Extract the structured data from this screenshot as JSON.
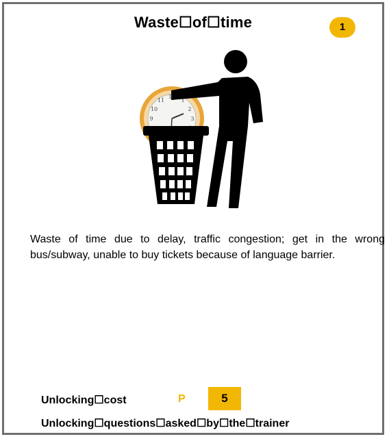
{
  "card": {
    "title": "Waste☐of☐time",
    "number": "1",
    "description": "Waste of time due to delay, traffic congestion; get in the wrong bus/subway, unable to buy tickets because of language barrier.",
    "unlocking_cost_label": "Unlocking☐cost",
    "cost_currency": "P",
    "cost_value": "5",
    "unlocking_questions_label": "Unlocking☐questions☐asked☐by☐the☐trainer"
  },
  "illustration": {
    "icons": [
      "person-icon",
      "trash-bin-icon",
      "clock-icon"
    ],
    "clock_frame_color": "#e8a53a",
    "figure_color": "#000000"
  },
  "colors": {
    "accent": "#f2b705",
    "border": "#6f6f6f"
  }
}
